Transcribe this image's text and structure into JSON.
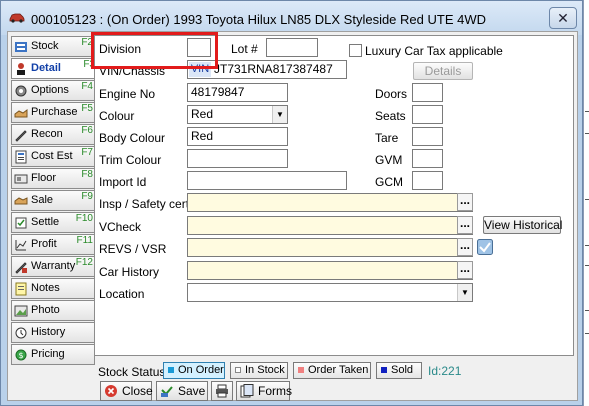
{
  "window": {
    "title": "000105123 : (On Order) 1993 Toyota Hilux LN85 DLX Styleside Red UTE 4WD",
    "close_glyph": "✕"
  },
  "tabs": [
    {
      "label": "Stock",
      "fkey": "F2",
      "icon": "stock-icon"
    },
    {
      "label": "Detail",
      "fkey": "F3",
      "icon": "detail-icon",
      "active": true
    },
    {
      "label": "Options",
      "fkey": "F4",
      "icon": "options-icon"
    },
    {
      "label": "Purchase",
      "fkey": "F5",
      "icon": "purchase-icon"
    },
    {
      "label": "Recon",
      "fkey": "F6",
      "icon": "recon-icon"
    },
    {
      "label": "Cost Est",
      "fkey": "F7",
      "icon": "cost-est-icon"
    },
    {
      "label": "Floor",
      "fkey": "F8",
      "icon": "floor-icon"
    },
    {
      "label": "Sale",
      "fkey": "F9",
      "icon": "sale-icon"
    },
    {
      "label": "Settle",
      "fkey": "F10",
      "icon": "settle-icon"
    },
    {
      "label": "Profit",
      "fkey": "F11",
      "icon": "profit-icon"
    },
    {
      "label": "Warranty",
      "fkey": "F12",
      "icon": "warranty-icon"
    },
    {
      "label": "Notes",
      "fkey": "",
      "icon": "notes-icon"
    },
    {
      "label": "Photo",
      "fkey": "",
      "icon": "photo-icon"
    },
    {
      "label": "History",
      "fkey": "",
      "icon": "history-icon"
    },
    {
      "label": "Pricing",
      "fkey": "",
      "icon": "pricing-icon"
    }
  ],
  "detail": {
    "division_label": "Division",
    "division_value": "",
    "lot_label": "Lot #",
    "lot_value": "",
    "luxury_tax_label": "Luxury Car Tax applicable",
    "luxury_tax_checked": false,
    "vin_label": "VIN/Chassis",
    "vin_tag": "VIN",
    "vin_value": "JT731RNA817387487",
    "details_button": "Details",
    "engine_label": "Engine No",
    "engine_value": "48179847",
    "doors_label": "Doors",
    "doors_value": "",
    "colour_label": "Colour",
    "colour_value": "Red",
    "seats_label": "Seats",
    "seats_value": "",
    "body_colour_label": "Body Colour",
    "body_colour_value": "Red",
    "tare_label": "Tare",
    "tare_value": "",
    "trim_colour_label": "Trim Colour",
    "trim_colour_value": "",
    "gvm_label": "GVM",
    "gvm_value": "",
    "import_label": "Import Id",
    "import_value": "",
    "gcm_label": "GCM",
    "gcm_value": "",
    "insp_label": "Insp / Safety cert",
    "insp_value": "",
    "vcheck_label": "VCheck",
    "vcheck_value": "",
    "view_historical_button": "View Historical",
    "revs_label": "REVS / VSR",
    "revs_value": "",
    "car_history_label": "Car History",
    "car_history_value": "",
    "location_label": "Location",
    "location_value": "",
    "ellipsis": "..."
  },
  "status": {
    "label": "Stock Status",
    "options": [
      {
        "label": "On Order",
        "selected": true,
        "color": "#1a9ad6"
      },
      {
        "label": "In Stock",
        "selected": false,
        "color": "#ffffff"
      },
      {
        "label": "Order Taken",
        "selected": false,
        "color": "#f08080"
      },
      {
        "label": "Sold",
        "selected": false,
        "color": "#1020c0"
      }
    ],
    "id_text": "Id:221"
  },
  "buttons": {
    "close": "Close",
    "save": "Save",
    "forms": "Forms"
  },
  "colors": {
    "highlight": "#e21b1b",
    "fkey_green": "#2a8a2a",
    "active_tab_text": "#1240a8",
    "yellow_field": "#fffbe0"
  }
}
